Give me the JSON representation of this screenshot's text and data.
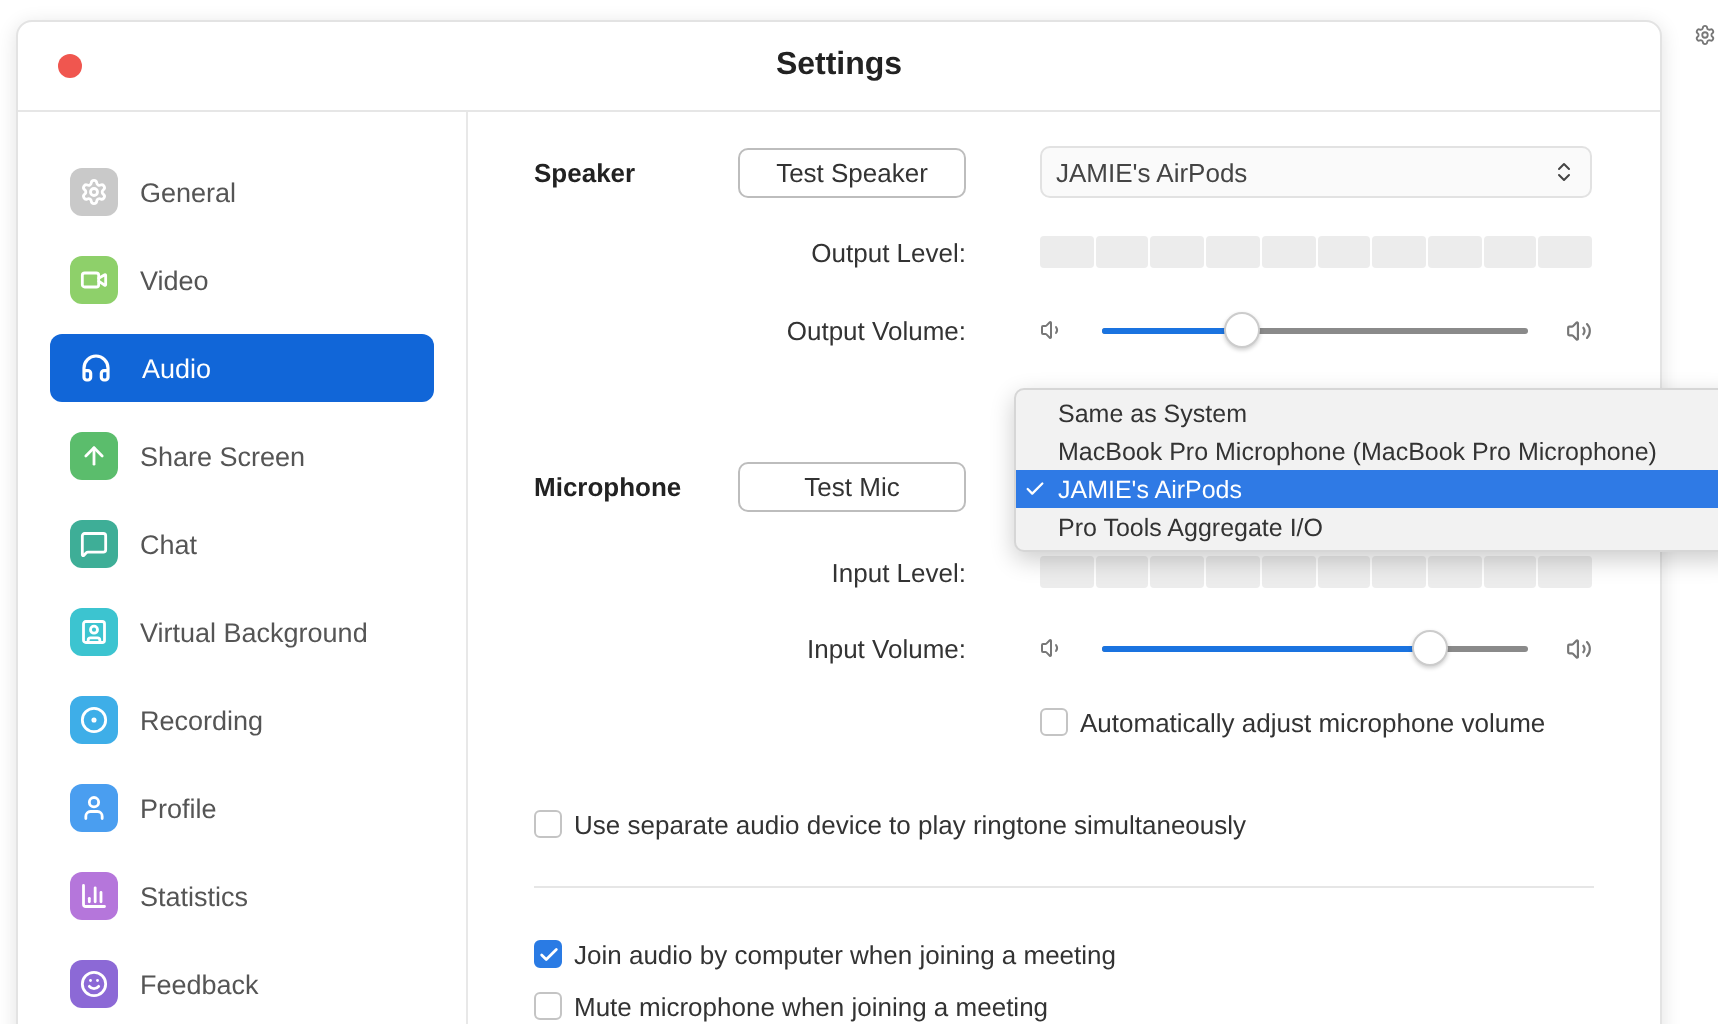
{
  "window": {
    "title": "Settings"
  },
  "sidebar": {
    "items": [
      {
        "label": "General",
        "kind": "general",
        "color": "#c9c9c9",
        "selected": false
      },
      {
        "label": "Video",
        "kind": "video",
        "color": "#8ed06a",
        "selected": false
      },
      {
        "label": "Audio",
        "kind": "audio",
        "selected": true
      },
      {
        "label": "Share Screen",
        "kind": "share",
        "color": "#5bbd6c",
        "selected": false
      },
      {
        "label": "Chat",
        "kind": "chat",
        "color": "#3eae97",
        "selected": false
      },
      {
        "label": "Virtual Background",
        "kind": "background",
        "color": "#3cc4d0",
        "selected": false
      },
      {
        "label": "Recording",
        "kind": "recording",
        "color": "#3eaee8",
        "selected": false
      },
      {
        "label": "Profile",
        "kind": "profile",
        "color": "#4a9ef0",
        "selected": false
      },
      {
        "label": "Statistics",
        "kind": "statistics",
        "color": "#b576db",
        "selected": false
      },
      {
        "label": "Feedback",
        "kind": "feedback",
        "color": "#8c69d6",
        "selected": false
      }
    ]
  },
  "speaker": {
    "label": "Speaker",
    "test_button": "Test Speaker",
    "device": "JAMIE's AirPods",
    "output_level_label": "Output Level:",
    "output_volume_label": "Output Volume:",
    "output_volume": {
      "level": 0.33
    }
  },
  "microphone": {
    "label": "Microphone",
    "test_button": "Test Mic",
    "input_level_label": "Input Level:",
    "input_volume_label": "Input Volume:",
    "input_volume": {
      "level": 0.77
    },
    "auto_adjust": {
      "label": "Automatically adjust microphone volume",
      "checked": false
    }
  },
  "device_menu": {
    "items": [
      {
        "label": "Same as System",
        "selected": false
      },
      {
        "label": "MacBook Pro Microphone (MacBook Pro Microphone)",
        "selected": false
      },
      {
        "label": "JAMIE's AirPods",
        "selected": true
      },
      {
        "label": "Pro Tools Aggregate I/O",
        "selected": false
      }
    ]
  },
  "option_groups": [
    [
      {
        "label": "Use separate audio device to play ringtone simultaneously",
        "checked": false
      }
    ],
    [
      {
        "label": "Join audio by computer when joining a meeting",
        "checked": true
      },
      {
        "label": "Mute microphone when joining a meeting",
        "checked": false
      }
    ]
  ]
}
